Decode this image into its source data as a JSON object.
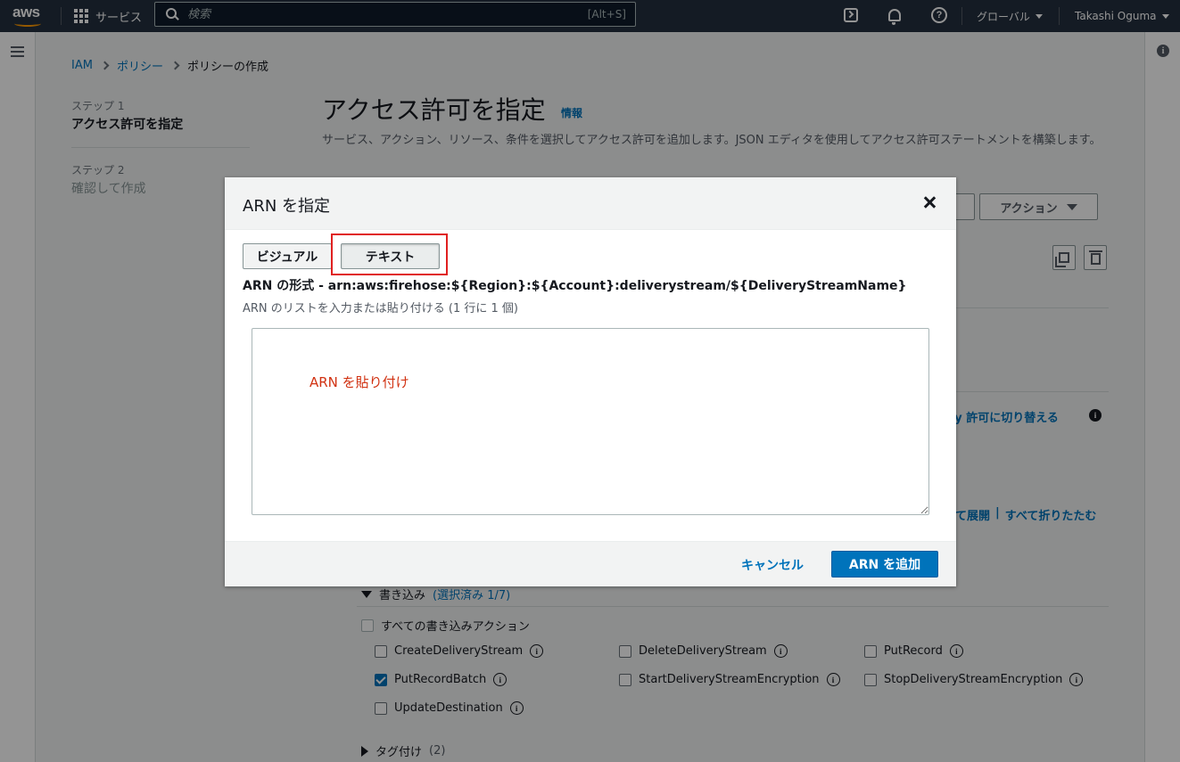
{
  "topnav": {
    "logo": "aws",
    "services_label": "サービス",
    "search_placeholder": "検索",
    "search_shortcut": "[Alt+S]",
    "region_label": "グローバル",
    "user_label": "Takashi Oguma",
    "icons": [
      "grid-icon",
      "search-icon",
      "cloudshell-icon",
      "bell-icon",
      "help-icon"
    ]
  },
  "breadcrumb": [
    "IAM",
    "ポリシー",
    "ポリシーの作成"
  ],
  "steps": [
    {
      "label": "ステップ 1",
      "title": "アクセス許可を指定"
    },
    {
      "label": "ステップ 2",
      "title": "確認して作成"
    }
  ],
  "main": {
    "title": "アクセス許可を指定",
    "info_link": "情報",
    "description": "サービス、アクション、リソース、条件を選択してアクセス許可を追加します。JSON エディタを使用してアクセス許可ステートメントを構築します。",
    "actions_button": "アクション",
    "deny_toggle": "ny 許可に切り替える",
    "expand_all": "て展開",
    "separator": "|",
    "collapse_all": "すべて折りたたむ"
  },
  "write_section": {
    "heading": "書き込み",
    "selected": "(選択済み 1/7)",
    "all_actions": "すべての書き込みアクション",
    "actions": [
      {
        "name": "CreateDeliveryStream",
        "checked": false
      },
      {
        "name": "DeleteDeliveryStream",
        "checked": false
      },
      {
        "name": "PutRecord",
        "checked": false
      },
      {
        "name": "PutRecordBatch",
        "checked": true
      },
      {
        "name": "StartDeliveryStreamEncryption",
        "checked": false
      },
      {
        "name": "StopDeliveryStreamEncryption",
        "checked": false
      },
      {
        "name": "UpdateDestination",
        "checked": false
      }
    ]
  },
  "tag_section": {
    "heading": "タグ付け",
    "count": "(2)"
  },
  "modal": {
    "title": "ARN を指定",
    "tab_visual": "ビジュアル",
    "tab_text": "テキスト",
    "arn_format": "ARN の形式 - arn:aws:firehose:${Region}:${Account}:deliverystream/${DeliveryStreamName}",
    "arn_hint": "ARN のリストを入力または貼り付ける (1 行に 1 個)",
    "textarea_value": "",
    "annotation": "ARN を貼り付け",
    "cancel_label": "キャンセル",
    "add_label": "ARN を追加"
  },
  "colors": {
    "nav_bg": "#232f3e",
    "link": "#0073bb",
    "primary_button": "#0073bb",
    "highlight": "#e02020",
    "annotation": "#d13212"
  }
}
